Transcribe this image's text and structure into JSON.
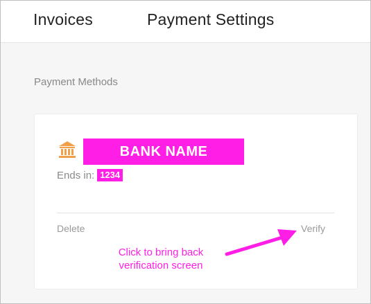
{
  "tabs": [
    {
      "label": "Invoices"
    },
    {
      "label": "Payment Settings"
    }
  ],
  "section": {
    "title": "Payment Methods"
  },
  "card": {
    "bank_name": "BANK NAME",
    "ends_label": "Ends in:",
    "last4": "1234",
    "delete_label": "Delete",
    "verify_label": "Verify",
    "icon": "bank-icon"
  },
  "annotation": {
    "line1": "Click to bring back",
    "line2": "verification screen"
  },
  "colors": {
    "highlight": "#ff1ee6",
    "bank_icon": "#f0a04b",
    "muted_text": "#8a8a8a"
  }
}
